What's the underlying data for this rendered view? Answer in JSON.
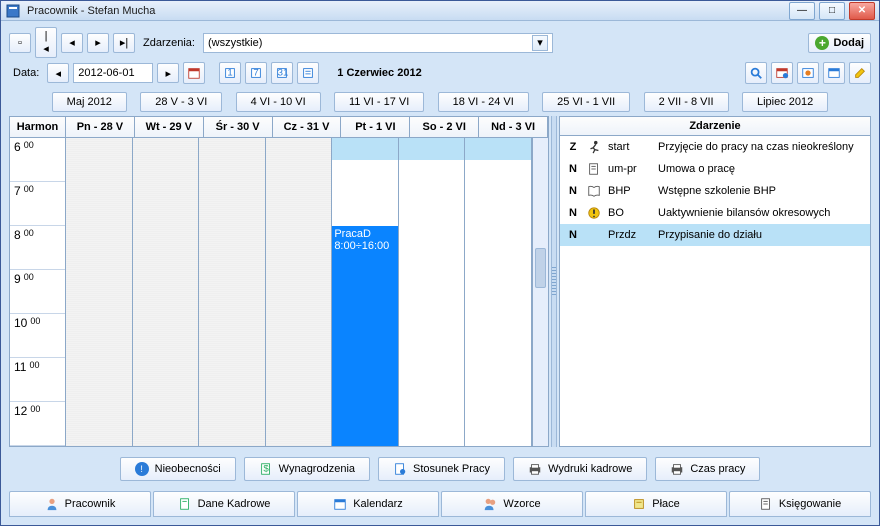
{
  "window": {
    "title": "Pracownik - Stefan Mucha"
  },
  "toolbar1": {
    "events_label": "Zdarzenia:",
    "filter_value": "(wszystkie)",
    "add_label": "Dodaj"
  },
  "toolbar2": {
    "data_label": "Data:",
    "date_value": "2012-06-01",
    "date_title": "1 Czerwiec 2012"
  },
  "ranges": [
    "Maj 2012",
    "28 V - 3 VI",
    "4 VI - 10 VI",
    "11 VI - 17 VI",
    "18 VI - 24 VI",
    "25 VI - 1 VII",
    "2 VII - 8 VII",
    "Lipiec 2012"
  ],
  "schedule": {
    "harmon": "Harmon",
    "days": [
      "Pn - 28 V",
      "Wt - 29 V",
      "Śr - 30 V",
      "Cz - 31 V",
      "Pt - 1 VI",
      "So - 2 VI",
      "Nd - 3 VI"
    ],
    "hours": [
      "6",
      "7",
      "8",
      "9",
      "10",
      "11",
      "12"
    ],
    "min": "00",
    "event": {
      "title": "PracaD",
      "time": "8:00÷16:00"
    }
  },
  "events": {
    "header": "Zdarzenie",
    "rows": [
      {
        "flag": "Z",
        "code": "start",
        "desc": "Przyjęcie do pracy na czas nieokreślony",
        "icon": "run"
      },
      {
        "flag": "N",
        "code": "um-pr",
        "desc": "Umowa o pracę",
        "icon": "doc"
      },
      {
        "flag": "N",
        "code": "BHP",
        "desc": "Wstępne szkolenie BHP",
        "icon": "book"
      },
      {
        "flag": "N",
        "code": "BO",
        "desc": "Uaktywnienie bilansów okresowych",
        "icon": "warn"
      },
      {
        "flag": "N",
        "code": "Przdz",
        "desc": "Przypisanie do działu",
        "icon": "none",
        "sel": true
      }
    ]
  },
  "actions": [
    "Nieobecności",
    "Wynagrodzenia",
    "Stosunek Pracy",
    "Wydruki kadrowe",
    "Czas pracy"
  ],
  "tabs": [
    "Pracownik",
    "Dane Kadrowe",
    "Kalendarz",
    "Wzorce",
    "Płace",
    "Księgowanie"
  ]
}
